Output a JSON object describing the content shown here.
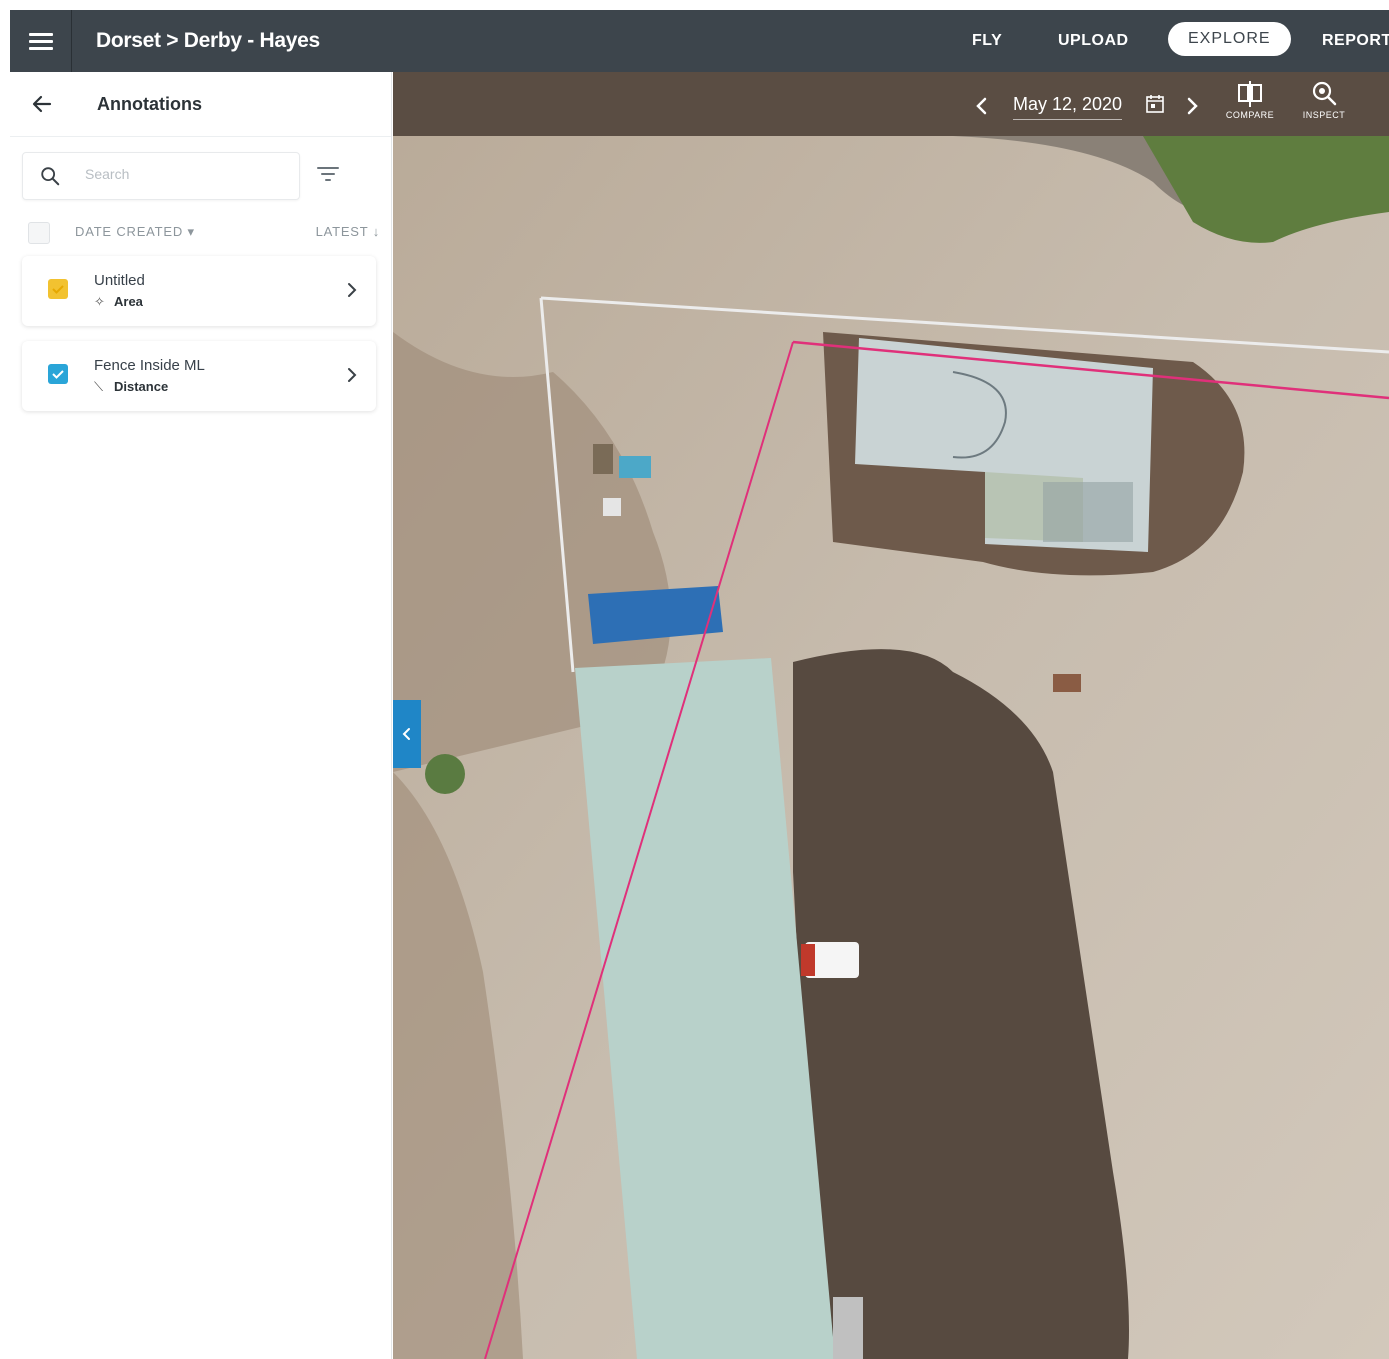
{
  "header": {
    "breadcrumb": "Dorset > Derby - Hayes",
    "nav": {
      "fly": "FLY",
      "upload": "UPLOAD",
      "explore": "EXPLORE",
      "report": "REPORT"
    }
  },
  "sidebar": {
    "title": "Annotations",
    "search_placeholder": "Search",
    "sort": {
      "field": "DATE CREATED ▾",
      "order": "LATEST ↓"
    },
    "annotations": [
      {
        "title": "Untitled",
        "type": "Area",
        "type_icon": "area-icon",
        "color": "#f2c230"
      },
      {
        "title": "Fence Inside ML",
        "type": "Distance",
        "type_icon": "distance-icon",
        "color": "#2aa5d8"
      }
    ]
  },
  "map": {
    "date": "May 12, 2020",
    "tools": {
      "compare": "COMPARE",
      "inspect": "INSPECT"
    },
    "annotation_line_color": "#e0307a"
  },
  "colors": {
    "topbar": "#3d454c",
    "accent": "#1f86c7"
  }
}
